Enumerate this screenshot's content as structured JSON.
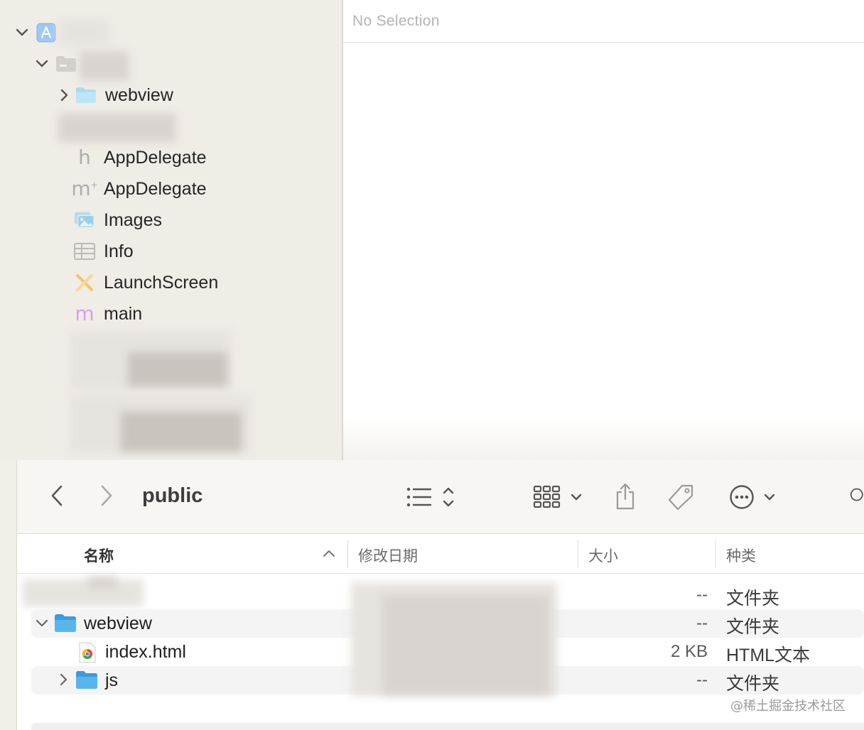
{
  "xcode": {
    "editor_placeholder": "No Selection",
    "tree": {
      "webview_folder": "webview",
      "files": [
        {
          "label": "AppDelegate",
          "icon": "header-file-icon"
        },
        {
          "label": "AppDelegate",
          "icon": "objc-implementation-icon"
        },
        {
          "label": "Images",
          "icon": "asset-catalog-icon"
        },
        {
          "label": "Info",
          "icon": "plist-icon"
        },
        {
          "label": "LaunchScreen",
          "icon": "storyboard-icon"
        },
        {
          "label": "main",
          "icon": "objc-source-icon"
        }
      ]
    }
  },
  "finder": {
    "folder_title": "public",
    "columns": {
      "name": "名称",
      "date": "修改日期",
      "size": "大小",
      "kind": "种类"
    },
    "rows": [
      {
        "name": "",
        "size": "--",
        "kind": "文件夹"
      },
      {
        "name": "webview",
        "size": "--",
        "kind": "文件夹"
      },
      {
        "name": "index.html",
        "size": "2 KB",
        "kind": "HTML文本"
      },
      {
        "name": "js",
        "size": "--",
        "kind": "文件夹"
      }
    ],
    "watermark": "@稀土掘金技术社区"
  },
  "colors": {
    "folder_blue": "#5ab6ea",
    "sidebar_bg": "#f0ece6",
    "toolbar_bg": "#f8f6f2"
  }
}
